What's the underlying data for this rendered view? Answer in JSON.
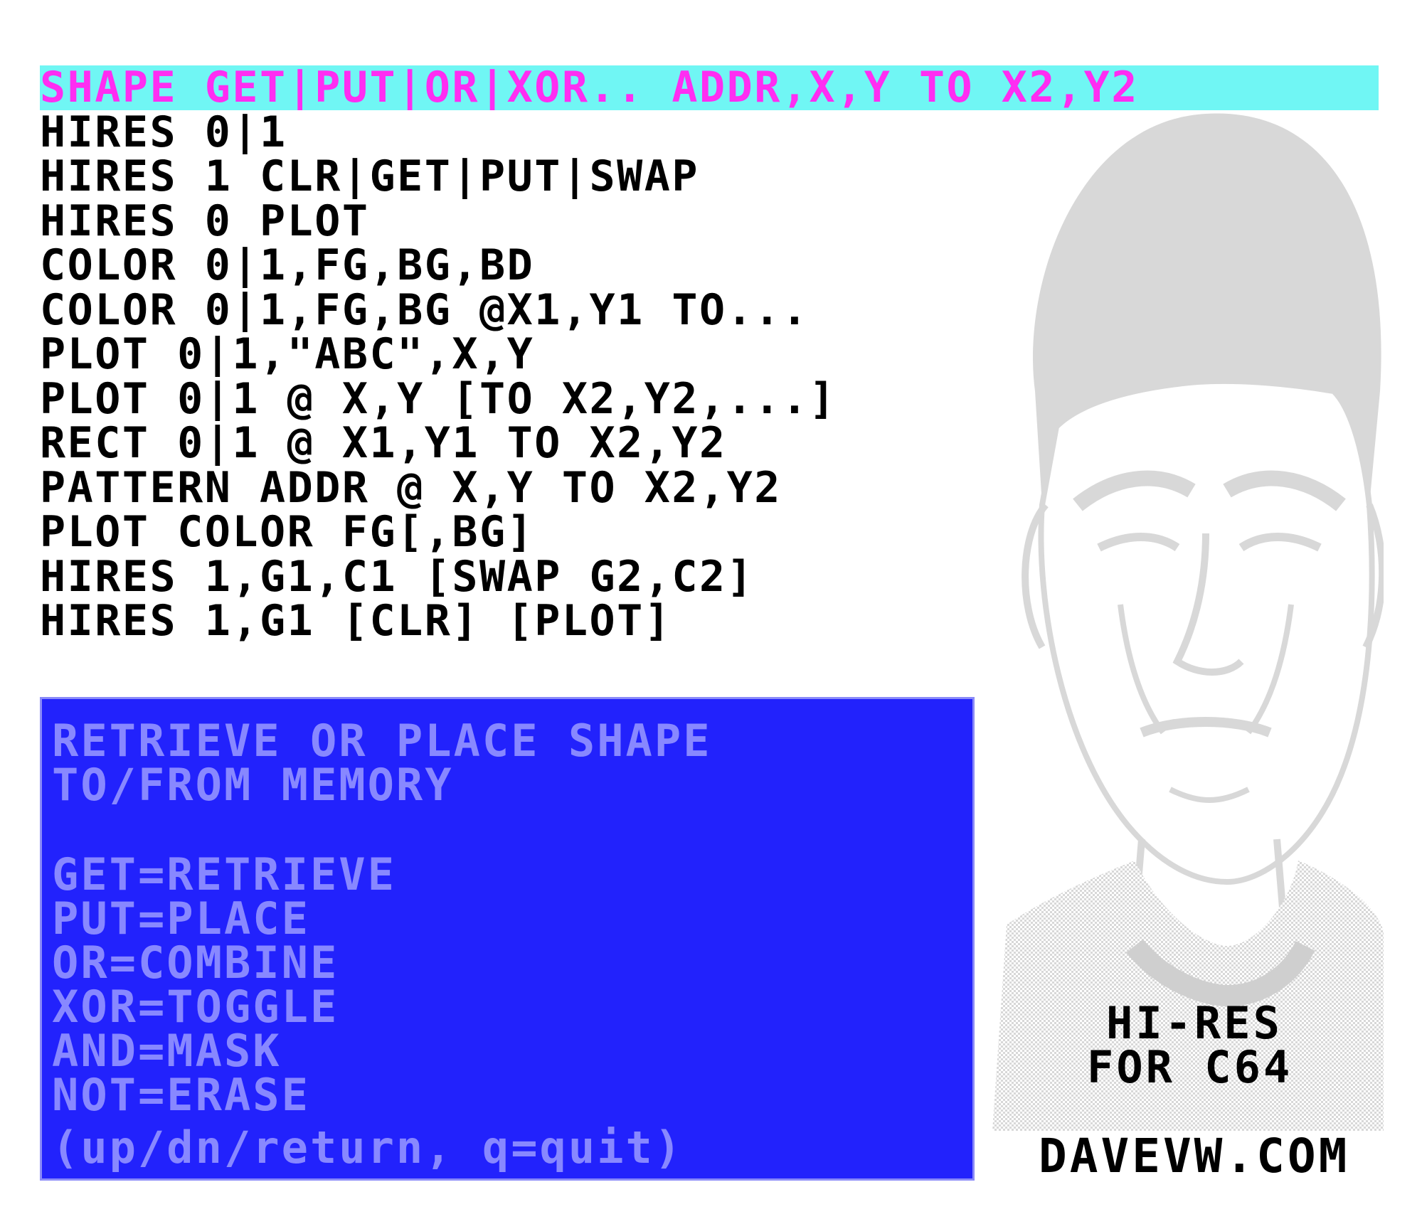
{
  "menu": {
    "items": [
      "SHAPE GET|PUT|OR|XOR.. ADDR,X,Y TO X2,Y2",
      "HIRES 0|1",
      "HIRES 1 CLR|GET|PUT|SWAP",
      "HIRES 0 PLOT",
      "COLOR 0|1,FG,BG,BD",
      "COLOR 0|1,FG,BG @X1,Y1 TO...",
      "PLOT 0|1,\"ABC\",X,Y",
      "PLOT 0|1 @ X,Y [TO X2,Y2,...]",
      "RECT 0|1 @ X1,Y1 TO X2,Y2",
      "PATTERN ADDR @ X,Y TO X2,Y2",
      "PLOT COLOR FG[,BG]",
      "HIRES 1,G1,C1 [SWAP G2,C2]",
      "HIRES 1,G1 [CLR] [PLOT]"
    ],
    "selected_index": 0
  },
  "help": {
    "line_1": "RETRIEVE OR PLACE SHAPE",
    "line_2": "TO/FROM MEMORY",
    "line_3": "GET=RETRIEVE",
    "line_4": "PUT=PLACE",
    "line_5": "OR=COMBINE",
    "line_6": "XOR=TOGGLE",
    "line_7": "AND=MASK",
    "line_8": "NOT=ERASE",
    "hint": "(up/dn/return, q=quit)"
  },
  "branding": {
    "line_1": "HI-RES",
    "line_2": "FOR C64",
    "site": "DAVEVW.COM"
  },
  "colors": {
    "highlight_bg": "#70f6f4",
    "highlight_fg": "#ff2df2",
    "help_bg": "#2222fc",
    "help_fg": "#8888ff",
    "portrait": "#dcdcdc"
  },
  "icons": {
    "portrait": "spock-portrait-image"
  }
}
